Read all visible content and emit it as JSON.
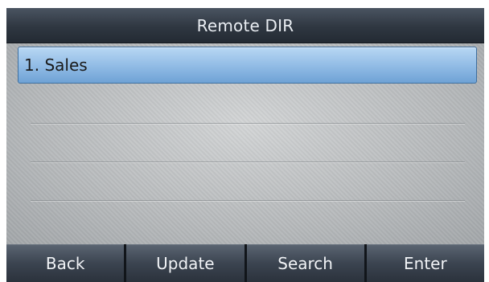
{
  "header": {
    "title": "Remote DIR"
  },
  "list": {
    "items": [
      {
        "label": "1. Sales",
        "selected": true
      }
    ]
  },
  "softkeys": [
    {
      "label": "Back"
    },
    {
      "label": "Update"
    },
    {
      "label": "Search"
    },
    {
      "label": "Enter"
    }
  ],
  "colors": {
    "selected_row": "#93bde6",
    "titlebar": "#2f3741",
    "softkey": "#3b4450",
    "content_bg": "#b7babc"
  }
}
